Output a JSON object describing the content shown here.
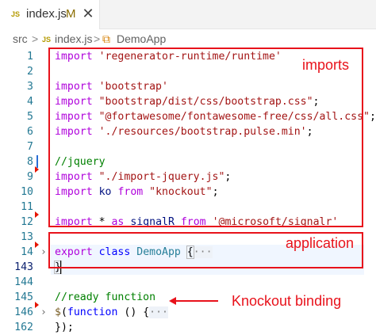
{
  "tab": {
    "badge": "JS",
    "filename": "index.js",
    "modified": "M",
    "close": "✕"
  },
  "breadcrumb": {
    "folder": "src",
    "sep1": ">",
    "file_badge": "JS",
    "file": "index.js",
    "sep2": ">",
    "class_icon": "⧉",
    "symbol": "DemoApp"
  },
  "lines": [
    {
      "num": "1",
      "parts": [
        {
          "t": "import",
          "c": "kw"
        },
        {
          "t": " ",
          "c": ""
        },
        {
          "t": "'regenerator-runtime/runtime'",
          "c": "str"
        }
      ]
    },
    {
      "num": "2",
      "parts": []
    },
    {
      "num": "3",
      "parts": [
        {
          "t": "import",
          "c": "kw"
        },
        {
          "t": " ",
          "c": ""
        },
        {
          "t": "'bootstrap'",
          "c": "str"
        }
      ]
    },
    {
      "num": "4",
      "parts": [
        {
          "t": "import",
          "c": "kw"
        },
        {
          "t": " ",
          "c": ""
        },
        {
          "t": "\"bootstrap/dist/css/bootstrap.css\"",
          "c": "str"
        },
        {
          "t": ";",
          "c": "punct"
        }
      ]
    },
    {
      "num": "5",
      "parts": [
        {
          "t": "import",
          "c": "kw"
        },
        {
          "t": " ",
          "c": ""
        },
        {
          "t": "\"@fortawesome/fontawesome-free/css/all.css\"",
          "c": "str"
        },
        {
          "t": ";",
          "c": "punct"
        }
      ]
    },
    {
      "num": "6",
      "parts": [
        {
          "t": "import",
          "c": "kw"
        },
        {
          "t": " ",
          "c": ""
        },
        {
          "t": "'./resources/bootstrap.pulse.min'",
          "c": "str"
        },
        {
          "t": ";",
          "c": "punct"
        }
      ]
    },
    {
      "num": "7",
      "parts": []
    },
    {
      "num": "8",
      "parts": [
        {
          "t": "//jquery",
          "c": "cm"
        }
      ]
    },
    {
      "num": "9",
      "parts": [
        {
          "t": "import",
          "c": "kw"
        },
        {
          "t": " ",
          "c": ""
        },
        {
          "t": "\"./import-jquery.js\"",
          "c": "str"
        },
        {
          "t": ";",
          "c": "punct"
        }
      ]
    },
    {
      "num": "10",
      "parts": [
        {
          "t": "import",
          "c": "kw"
        },
        {
          "t": " ",
          "c": ""
        },
        {
          "t": "ko",
          "c": "var"
        },
        {
          "t": " ",
          "c": ""
        },
        {
          "t": "from",
          "c": "kw"
        },
        {
          "t": " ",
          "c": ""
        },
        {
          "t": "\"knockout\"",
          "c": "str"
        },
        {
          "t": ";",
          "c": "punct"
        }
      ]
    },
    {
      "num": "11",
      "parts": []
    },
    {
      "num": "12",
      "parts": [
        {
          "t": "import",
          "c": "kw"
        },
        {
          "t": " * ",
          "c": ""
        },
        {
          "t": "as",
          "c": "kw"
        },
        {
          "t": " ",
          "c": ""
        },
        {
          "t": "signalR",
          "c": "var"
        },
        {
          "t": " ",
          "c": ""
        },
        {
          "t": "from",
          "c": "kw"
        },
        {
          "t": " ",
          "c": ""
        },
        {
          "t": "'@microsoft/signalr'",
          "c": "str"
        }
      ]
    },
    {
      "num": "13",
      "parts": []
    },
    {
      "num": "14",
      "parts": [
        {
          "t": "export",
          "c": "kw"
        },
        {
          "t": " ",
          "c": ""
        },
        {
          "t": "class",
          "c": "kw2"
        },
        {
          "t": " ",
          "c": ""
        },
        {
          "t": "DemoApp",
          "c": "id"
        },
        {
          "t": " ",
          "c": ""
        },
        {
          "t": "{",
          "c": "punct brace-box"
        },
        {
          "t": "···",
          "c": "fold-ell"
        }
      ]
    },
    {
      "num": "143",
      "parts": [
        {
          "t": "}",
          "c": "punct brace-box"
        }
      ]
    },
    {
      "num": "144",
      "parts": []
    },
    {
      "num": "145",
      "parts": [
        {
          "t": "//ready function",
          "c": "cm"
        }
      ]
    },
    {
      "num": "146",
      "parts": [
        {
          "t": "$",
          "c": "fn"
        },
        {
          "t": "(",
          "c": "punct"
        },
        {
          "t": "function",
          "c": "kw2"
        },
        {
          "t": " () {",
          "c": "punct"
        },
        {
          "t": "···",
          "c": "fold-ell"
        }
      ]
    },
    {
      "num": "162",
      "parts": [
        {
          "t": "});",
          "c": "punct"
        }
      ]
    }
  ],
  "labels": {
    "imports": "imports",
    "application": "application",
    "knockout_binding": "Knockout binding"
  },
  "chevron": "›",
  "colors": {
    "highlight_box": "#e8121b",
    "keyword": "#af00db",
    "string": "#a31515",
    "comment": "#008000",
    "line_number": "#237893"
  }
}
